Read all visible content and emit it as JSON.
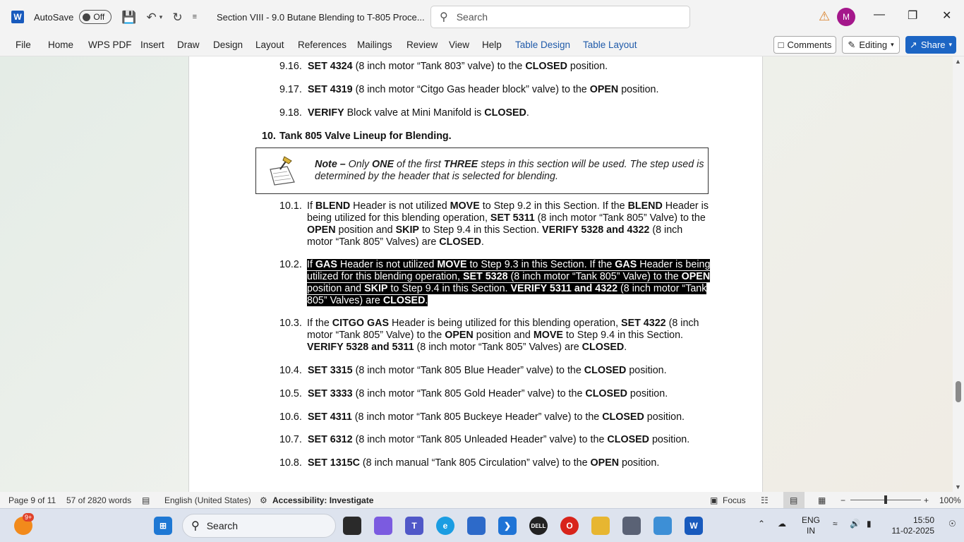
{
  "titlebar": {
    "autosave_label": "AutoSave",
    "autosave_state": "Off",
    "document_title": "Section VIII - 9.0 Butane Blending to T-805 Proce...",
    "search_placeholder": "Search",
    "avatar_initial": "M"
  },
  "ribbon": {
    "tabs": [
      "File",
      "Home",
      "WPS PDF",
      "Insert",
      "Draw",
      "Design",
      "Layout",
      "References",
      "Mailings",
      "Review",
      "View",
      "Help",
      "Table Design",
      "Table Layout"
    ],
    "comments_label": "Comments",
    "editing_label": "Editing",
    "share_label": "Share"
  },
  "document": {
    "s916": {
      "num": "9.16.",
      "a": "SET 4324",
      "b": " (8 inch motor “Tank 803” valve) to the ",
      "c": "CLOSED",
      "d": " position."
    },
    "s917": {
      "num": "9.17.",
      "a": "SET 4319",
      "b": " (8 inch motor “Citgo Gas header block” valve) to the ",
      "c": "OPEN",
      "d": " position."
    },
    "s918": {
      "num": "9.18.",
      "a": "VERIFY",
      "b": " Block valve at Mini Manifold is ",
      "c": "CLOSED",
      "d": "."
    },
    "s10": {
      "num": "10.",
      "title": "Tank 805 Valve Lineup for Blending."
    },
    "note": {
      "lead": "Note –",
      "t1": " Only ",
      "one": "ONE",
      "t2": " of the first ",
      "three": "THREE",
      "t3": " steps in this section will be used. The step used is determined by the header that is selected for blending."
    },
    "s101": {
      "num": "10.1.",
      "p1": "If ",
      "b1": "BLEND",
      "p2": " Header is not utilized ",
      "b2": "MOVE",
      "p3": " to Step 9.2 in this Section. If the ",
      "b3": "BLEND",
      "p4": " Header is being utilized for this blending operation, ",
      "b4": "SET 5311",
      "p5": " (8 inch motor “Tank 805” Valve) to the ",
      "b5": "OPEN",
      "p6": " position and ",
      "b6": "SKIP",
      "p7": " to Step 9.4 in this Section. ",
      "b7": "VERIFY 5328 and 4322",
      "p8": " (8 inch motor “Tank 805” Valves) are ",
      "b8": "CLOSED",
      "p9": "."
    },
    "s102": {
      "num": "10.2.",
      "p1": "If ",
      "b1": "GAS",
      "p2": " Header is not utilized ",
      "b2": "MOVE",
      "p3": " to Step 9.3 in this Section. If the ",
      "b3": "GAS",
      "p4": " Header is being utilized for this blending operation, ",
      "b4": "SET 5328",
      "p5": " (8 inch motor “Tank 805” Valve) to the ",
      "b5": "OPEN",
      "p6": " position and ",
      "b6": "SKIP",
      "p7": " to Step 9.4 in this Section. ",
      "b7": "VERIFY 5311 and 4322",
      "p8": " (8 inch motor “Tank 805” Valves) are ",
      "b8": "CLOSED",
      "p9": "."
    },
    "s103": {
      "num": "10.3.",
      "p1": "If the ",
      "b1": "CITGO GAS",
      "p2": " Header is being utilized for this blending operation, ",
      "b2": "SET 4322",
      "p3": " (8 inch motor “Tank 805” Valve) to the ",
      "b3": "OPEN",
      "p4": " position and ",
      "b4": "MOVE",
      "p5": " to Step 9.4 in this Section. ",
      "b5": "VERIFY 5328 and 5311",
      "p6": " (8 inch motor “Tank 805” Valves) are ",
      "b6": "CLOSED",
      "p7": "."
    },
    "s104": {
      "num": "10.4.",
      "a": "SET 3315",
      "b": " (8 inch motor “Tank 805 Blue Header” valve) to the ",
      "c": "CLOSED",
      "d": " position."
    },
    "s105": {
      "num": "10.5.",
      "a": "SET 3333",
      "b": " (8 inch motor “Tank 805 Gold Header” valve) to the ",
      "c": "CLOSED",
      "d": " position."
    },
    "s106": {
      "num": "10.6.",
      "a": "SET 4311",
      "b": " (8 inch motor “Tank 805 Buckeye Header” valve) to the ",
      "c": "CLOSED",
      "d": " position."
    },
    "s107": {
      "num": "10.7.",
      "a": "SET 6312",
      "b": " (8 inch motor “Tank 805 Unleaded Header” valve) to the ",
      "c": "CLOSED",
      "d": " position."
    },
    "s108": {
      "num": "10.8.",
      "a": "SET 1315C",
      "b": " (8 inch manual “Tank 805 Circulation” valve) to the ",
      "c": "OPEN",
      "d": " position."
    }
  },
  "statusbar": {
    "page": "Page 9 of 11",
    "words": "57 of 2820 words",
    "language": "English (United States)",
    "accessibility": "Accessibility: Investigate",
    "focus": "Focus",
    "zoom": "100%",
    "zoom_fraction": 0.5
  },
  "taskbar": {
    "search_placeholder": "Search",
    "notif_badge": "9+",
    "lang_top": "ENG",
    "lang_bottom": "IN",
    "time": "15:50",
    "date": "11-02-2025"
  }
}
